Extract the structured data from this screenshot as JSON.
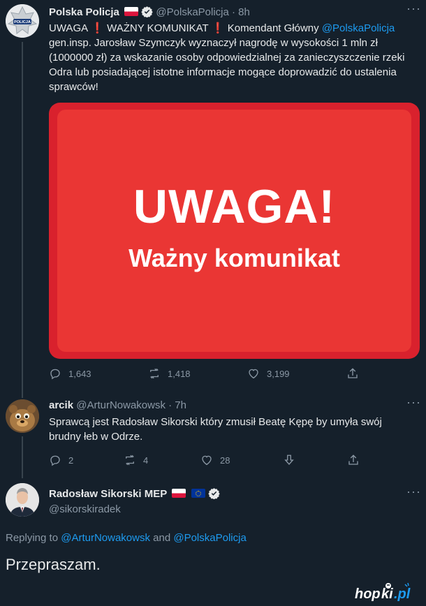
{
  "tweet1": {
    "author_name": "Polska Policja",
    "handle_time": "@PolskaPolicja · 8h",
    "avatar_label": "POLICJA",
    "text_prefix": "UWAGA",
    "text_mid": " WAŻNY KOMUNIKAT",
    "text_after": "  Komendant Główny ",
    "mention": "@PolskaPolicja",
    "text_rest": " gen.insp. Jarosław Szymczyk wyznaczył nagrodę w wysokości 1 mln zł (1000000 zł) za wskazanie osoby odpowiedzialnej za zanieczyszczenie rzeki Odra lub posiadającej istotne informacje mogące doprowadzić do ustalenia sprawców!",
    "media_title": "UWAGA!",
    "media_subtitle": "Ważny komunikat",
    "replies": "1,643",
    "retweets": "1,418",
    "likes": "3,199"
  },
  "tweet2": {
    "author_name": "arcik",
    "handle_time": "@ArturNowakowsk · 7h",
    "text": "Sprawcą jest Radosław Sikorski który zmusił Beatę Kępę by umyła swój brudny łeb w Odrze.",
    "replies": "2",
    "retweets": "4",
    "likes": "28"
  },
  "tweet3": {
    "author_name": "Radosław Sikorski MEP",
    "handle": "@sikorskiradek",
    "replying_prefix": "Replying to ",
    "replying_mention1": "@ArturNowakowsk",
    "replying_and": " and ",
    "replying_mention2": "@PolskaPolicja",
    "text": "Przepraszam."
  },
  "colors": {
    "background": "#15202b",
    "link": "#1d9bf0",
    "muted": "#8b98a5",
    "media_red": "#ea3634"
  },
  "watermark": "hopki.pl"
}
